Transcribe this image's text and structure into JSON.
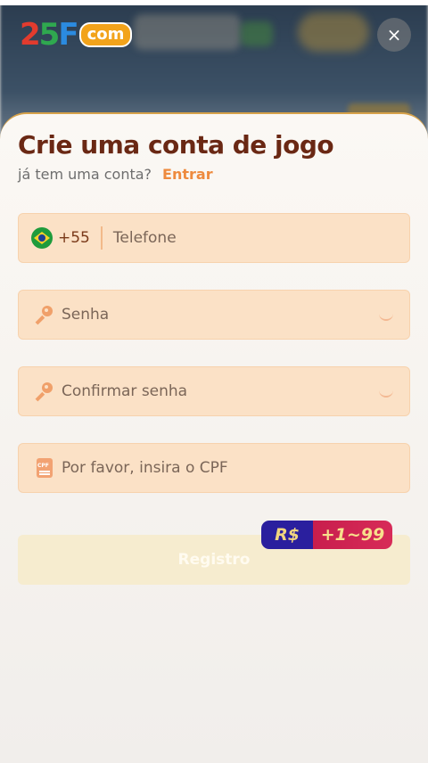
{
  "brand": {
    "logo_num_1": "2",
    "logo_num_2": "5",
    "logo_letter": "F",
    "logo_domain": "com"
  },
  "header": {
    "close_icon": "×"
  },
  "form": {
    "title": "Crie uma conta de jogo",
    "subtitle": "já tem uma conta?",
    "login_link": "Entrar",
    "phone": {
      "country_code": "+55",
      "placeholder": "Telefone",
      "flag_icon": "brazil-flag"
    },
    "password": {
      "placeholder": "Senha"
    },
    "confirm_password": {
      "placeholder": "Confirmar senha"
    },
    "cpf": {
      "placeholder": "Por favor, insira o CPF",
      "icon_text": "CPF"
    },
    "register_label": "Registro",
    "bonus": {
      "currency": "R$",
      "amount": "+1~99"
    }
  },
  "colors": {
    "title": "#6a2814",
    "link": "#ee8a3e",
    "field_bg": "#fbe1c6",
    "accent_border": "#d7a24a"
  }
}
